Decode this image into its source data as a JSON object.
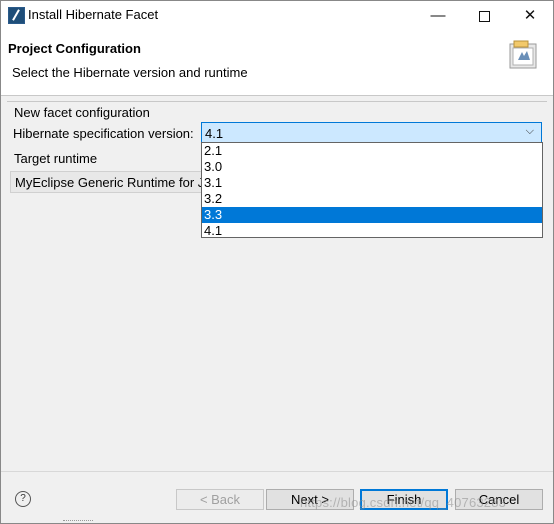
{
  "window": {
    "title": "Install Hibernate Facet",
    "controls": {
      "minimize": "—",
      "maximize": "",
      "close": "✕"
    }
  },
  "header": {
    "title": "Project Configuration",
    "subtitle": "Select the Hibernate version and runtime",
    "icon": "wizard-banner-icon"
  },
  "facet_group": {
    "title": "New facet configuration",
    "version_label": "Hibernate specification version:",
    "version_value": "4.1",
    "dropdown_options": [
      "2.1",
      "3.0",
      "3.1",
      "3.2",
      "3.3",
      "4.1"
    ],
    "highlighted_option": "3.3"
  },
  "runtime": {
    "label": "Target runtime",
    "value": "MyEclipse Generic Runtime for Ja"
  },
  "footer": {
    "help_icon": "?",
    "back_label": "< Back",
    "next_label": "Next >",
    "finish_label": "Finish",
    "cancel_label": "Cancel"
  },
  "watermark": "https://blog.csdn.net/qq_40763283",
  "colors": {
    "selection": "#0078d7",
    "combo_bg": "#cce8ff"
  }
}
